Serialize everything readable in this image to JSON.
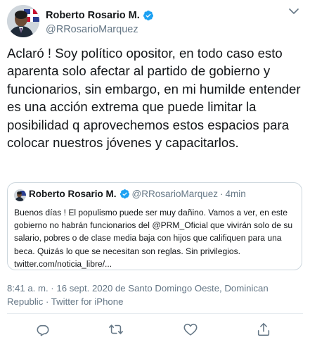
{
  "author": {
    "display_name": "Roberto Rosario M.",
    "handle": "@RRosarioMarquez"
  },
  "tweet": {
    "text": "Aclaró ! Soy político opositor, en todo caso esto aparenta solo afectar al partido de gobierno y funcionarios, sin embargo, en mi humilde entender es una acción extrema que puede limitar la posibilidad q aprovechemos estos espacios para colocar nuestros jóvenes y capacitarlos."
  },
  "quoted_tweet": {
    "display_name": "Roberto Rosario M.",
    "handle": "@RRosarioMarquez",
    "separator": "·",
    "time": "4min",
    "text": "Buenos días ! El populismo puede ser muy dañino. Vamos a ver, en este gobierno no habrán funcionarios del @PRM_Oficial que vivirán solo de su salario, pobres o de clase media baja  con hijos que califiquen para una beca. Quizás lo que se necesitan son reglas. Sin privilegios. twitter.com/noticia_libre/..."
  },
  "meta": {
    "text": "8:41 a. m. · 16 sept. 2020 de Santo Domingo Oeste, Dominican Republic · Twitter for iPhone"
  },
  "icons": {
    "verified": "verified-badge-icon",
    "more": "chevron-down-icon",
    "reply": "reply-icon",
    "retweet": "retweet-icon",
    "like": "heart-icon",
    "share": "share-icon"
  },
  "colors": {
    "verified": "#1da1f2",
    "secondary_text": "#657786",
    "border": "#ccd6dd"
  }
}
